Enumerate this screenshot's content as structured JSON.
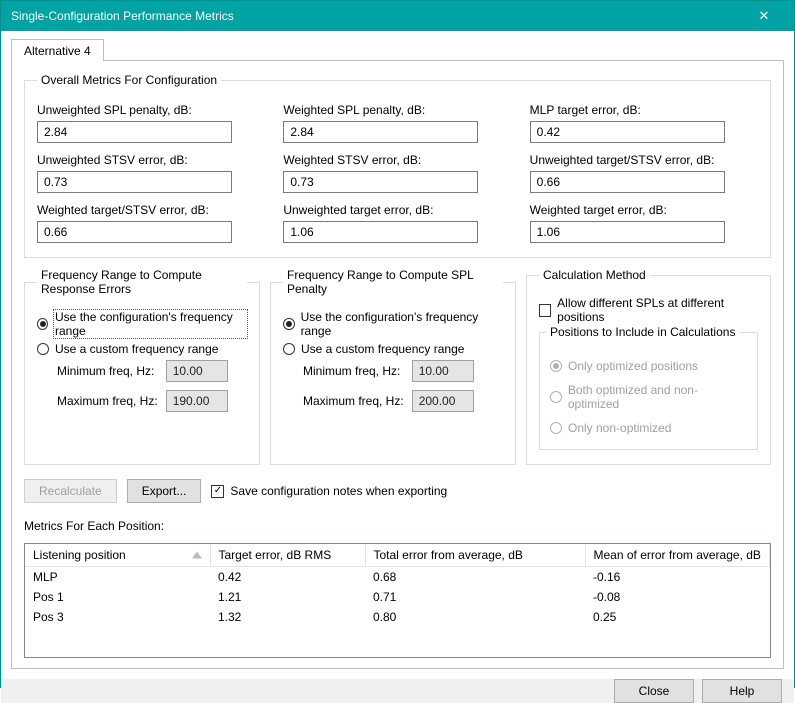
{
  "window": {
    "title": "Single-Configuration Performance Metrics"
  },
  "tab": {
    "label": "Alternative 4"
  },
  "overall": {
    "legend": "Overall Metrics For Configuration",
    "fields": {
      "unw_spl_label": "Unweighted SPL penalty, dB:",
      "unw_spl_val": "2.84",
      "w_spl_label": "Weighted SPL penalty, dB:",
      "w_spl_val": "2.84",
      "mlp_label": "MLP target error, dB:",
      "mlp_val": "0.42",
      "unw_stsv_label": "Unweighted STSV error, dB:",
      "unw_stsv_val": "0.73",
      "w_stsv_label": "Weighted STSV error, dB:",
      "w_stsv_val": "0.73",
      "unw_tstsv_label": "Unweighted target/STSV error, dB:",
      "unw_tstsv_val": "0.66",
      "w_tstsv_label": "Weighted target/STSV error, dB:",
      "w_tstsv_val": "0.66",
      "unw_targ_label": "Unweighted target error, dB:",
      "unw_targ_val": "1.06",
      "w_targ_label": "Weighted target error, dB:",
      "w_targ_val": "1.06"
    }
  },
  "freq_err": {
    "legend": "Frequency Range to Compute Response Errors",
    "opt_config": "Use the configuration's frequency range",
    "opt_custom": "Use a custom frequency range",
    "min_label": "Minimum freq, Hz:",
    "min_val": "10.00",
    "max_label": "Maximum freq, Hz:",
    "max_val": "190.00"
  },
  "freq_spl": {
    "legend": "Frequency Range to Compute SPL Penalty",
    "opt_config": "Use the configuration's frequency range",
    "opt_custom": "Use a custom frequency range",
    "min_label": "Minimum freq, Hz:",
    "min_val": "10.00",
    "max_label": "Maximum freq, Hz:",
    "max_val": "200.00"
  },
  "calc": {
    "legend": "Calculation Method",
    "allow_diff": "Allow different SPLs at different positions",
    "pos_legend": "Positions to Include in Calculations",
    "opt_only_opt": "Only optimized positions",
    "opt_both": "Both optimized and non-optimized",
    "opt_only_non": "Only non-optimized"
  },
  "actions": {
    "recalc": "Recalculate",
    "export": "Export...",
    "save_notes": "Save configuration notes when exporting"
  },
  "positions": {
    "label": "Metrics For Each Position:",
    "cols": {
      "pos": "Listening position",
      "targ": "Target error, dB RMS",
      "tot": "Total error from average, dB",
      "mean": "Mean of error from average, dB"
    },
    "rows": [
      {
        "pos": "MLP",
        "targ": "0.42",
        "tot": "0.68",
        "mean": "-0.16"
      },
      {
        "pos": "Pos 1",
        "targ": "1.21",
        "tot": "0.71",
        "mean": "-0.08"
      },
      {
        "pos": "Pos 3",
        "targ": "1.32",
        "tot": "0.80",
        "mean": "0.25"
      }
    ]
  },
  "footer": {
    "close": "Close",
    "help": "Help"
  }
}
